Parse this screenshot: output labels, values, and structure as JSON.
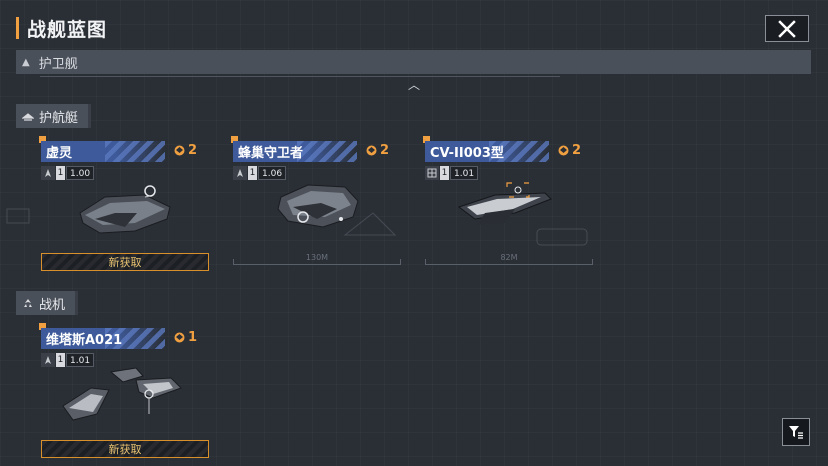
{
  "header": {
    "title": "战舰蓝图",
    "close_icon": "close-icon"
  },
  "section": {
    "label": "护卫舰",
    "icon": "triangle-up-icon"
  },
  "categories": [
    {
      "label": "护航艇",
      "icon": "escort-class-icon",
      "cards": [
        {
          "name": "虚灵",
          "count": "2",
          "tier": "1",
          "value": "1.00",
          "new_label": "新获取"
        },
        {
          "name": "蜂巢守卫者",
          "count": "2",
          "tier": "1",
          "value": "1.06",
          "scale": "130M"
        },
        {
          "name": "CV-II003型",
          "count": "2",
          "tier": "1",
          "value": "1.01",
          "scale": "82M"
        }
      ]
    },
    {
      "label": "战机",
      "icon": "fighter-class-icon",
      "cards": [
        {
          "name": "维塔斯A021",
          "count": "1",
          "tier": "1",
          "value": "1.01",
          "new_label": "新获取"
        }
      ]
    }
  ],
  "colors": {
    "accent": "#f0a040",
    "name_bar": "#3e5a9a",
    "background": "#2a2f36"
  },
  "filter_icon": "filter-icon"
}
